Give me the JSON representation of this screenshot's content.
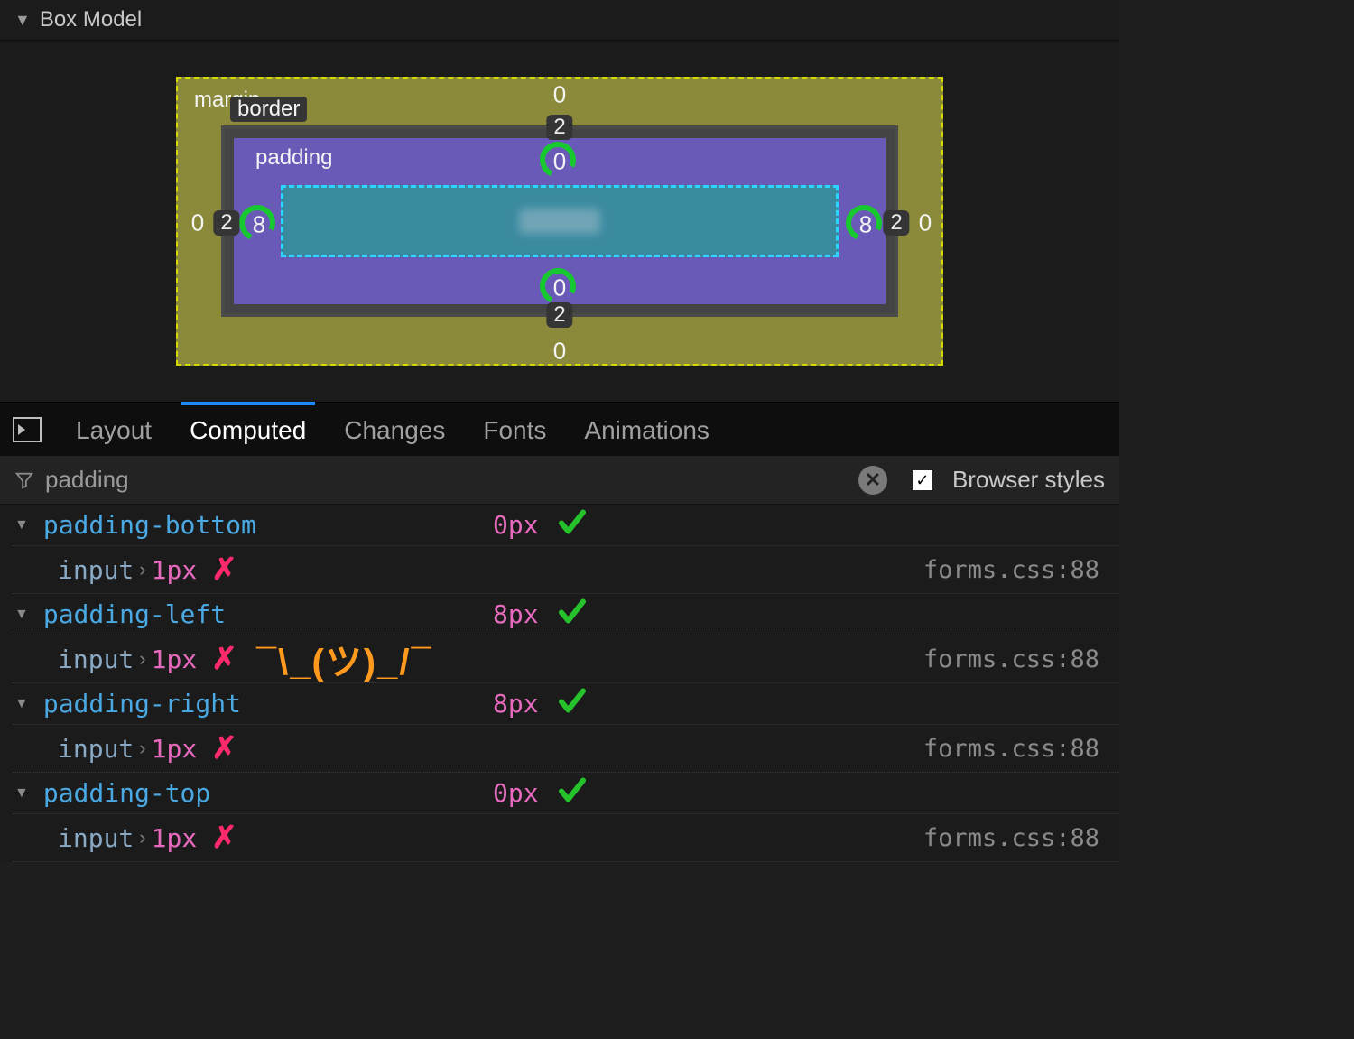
{
  "section_title": "Box Model",
  "boxmodel": {
    "labels": {
      "margin": "margin",
      "border": "border",
      "padding": "padding"
    },
    "margin": {
      "top": "0",
      "right": "0",
      "bottom": "0",
      "left": "0"
    },
    "border": {
      "top": "2",
      "right": "2",
      "bottom": "2",
      "left": "2"
    },
    "padding": {
      "top": "0",
      "right": "8",
      "bottom": "0",
      "left": "8"
    }
  },
  "tabs": {
    "layout": "Layout",
    "computed": "Computed",
    "changes": "Changes",
    "fonts": "Fonts",
    "animations": "Animations"
  },
  "filter": {
    "text": "padding",
    "browser_styles_label": "Browser styles",
    "browser_styles_checked": true
  },
  "annotations": {
    "shrug": "¯\\_(ツ)_/¯"
  },
  "props": [
    {
      "name": "padding-bottom",
      "value": "0px",
      "overridden": {
        "selector": "input",
        "value": "1px",
        "source": "forms.css:88"
      }
    },
    {
      "name": "padding-left",
      "value": "8px",
      "overridden": {
        "selector": "input",
        "value": "1px",
        "source": "forms.css:88",
        "shrug": true
      }
    },
    {
      "name": "padding-right",
      "value": "8px",
      "overridden": {
        "selector": "input",
        "value": "1px",
        "source": "forms.css:88"
      }
    },
    {
      "name": "padding-top",
      "value": "0px",
      "overridden": {
        "selector": "input",
        "value": "1px",
        "source": "forms.css:88"
      }
    }
  ]
}
